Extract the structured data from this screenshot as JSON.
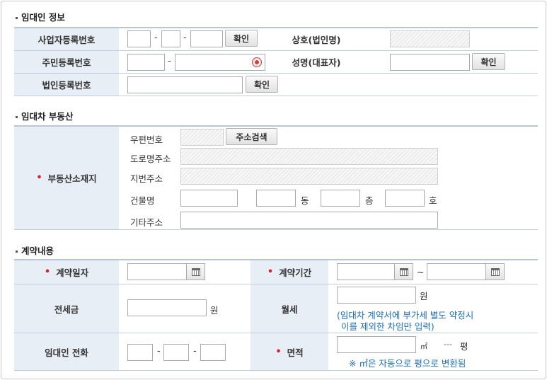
{
  "lessor": {
    "section_title": "임대인 정보",
    "biz_reg_label": "사업자등록번호",
    "resident_reg_label": "주민등록번호",
    "corp_reg_label": "법인등록번호",
    "trade_name_label": "상호(법인명)",
    "name_label": "성명(대표자)",
    "confirm_label": "확인"
  },
  "property": {
    "section_title": "임대차 부동산",
    "location_label": "부동산소재지",
    "zip_label": "우편번호",
    "search_address_label": "주소검색",
    "road_address_label": "도로명주소",
    "lot_address_label": "지번주소",
    "building_label": "건물명",
    "dong_label": "동",
    "floor_label": "층",
    "ho_label": "호",
    "other_address_label": "기타주소"
  },
  "contract": {
    "section_title": "계약내용",
    "date_label": "계약일자",
    "period_label": "계약기간",
    "period_sep": "~",
    "deposit_label": "전세금",
    "won": "원",
    "monthly_label": "월세",
    "monthly_note_1": "(임대차 계약서에 부가세 별도 약정시",
    "monthly_note_2": "이를 제외한 차임만 입력)",
    "phone_label": "임대인 전화",
    "area_label": "면적",
    "area_unit": "㎡",
    "pyeong_value": "---",
    "pyeong_unit": "평",
    "area_note": "※ ㎡은 자동으로 평으로 변환됨",
    "dash": "-",
    "required_mark": "•"
  }
}
